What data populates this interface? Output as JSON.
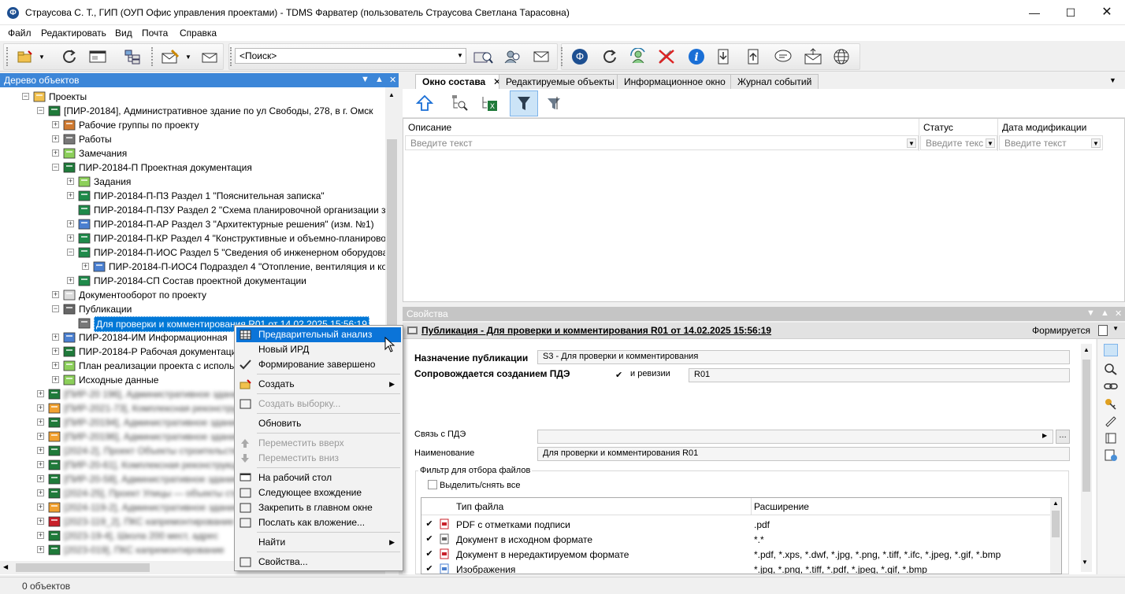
{
  "window": {
    "title": "Страусова С. Т., ГИП (ОУП Офис управления проектами) - TDMS Фарватер (пользователь Страусова Светлана Тарасовна)",
    "app_icon": "Ф"
  },
  "menu": [
    "Файл",
    "Редактировать",
    "Вид",
    "Почта",
    "Справка"
  ],
  "toolbar": {
    "search_placeholder": "<Поиск>"
  },
  "left_pane": {
    "title": "Дерево объектов",
    "tree": [
      {
        "label": "Проекты",
        "icon": "projects-icon",
        "level": 0
      },
      {
        "label": "[ПИР-20184], Административное здание по ул Свободы, 278, в г. Омск",
        "icon": "project-icon",
        "level": 1
      },
      {
        "label": "Рабочие группы по проекту",
        "icon": "group-icon",
        "level": 2
      },
      {
        "label": "Работы",
        "icon": "works-icon",
        "level": 2
      },
      {
        "label": "Замечания",
        "icon": "folder-green-icon",
        "level": 2
      },
      {
        "label": "ПИР-20184-П Проектная документация",
        "icon": "docs-icon",
        "level": 2
      },
      {
        "label": "Задания",
        "icon": "folder-green-icon",
        "level": 3
      },
      {
        "label": "ПИР-20184-П-ПЗ Раздел 1 \"Пояснительная записка\"",
        "icon": "section-icon",
        "level": 3
      },
      {
        "label": "ПИР-20184-П-ПЗУ Раздел 2 \"Схема планировочной организации з",
        "icon": "section-icon",
        "level": 3
      },
      {
        "label": "ПИР-20184-П-АР Раздел 3 \"Архитектурные решения\" (изм. №1)",
        "icon": "section-blue-icon",
        "level": 3
      },
      {
        "label": "ПИР-20184-П-КР Раздел 4 \"Конструктивные и объемно-планирово",
        "icon": "section-icon",
        "level": 3
      },
      {
        "label": "ПИР-20184-П-ИОС Раздел 5 \"Сведения об инженерном оборудова",
        "icon": "section-icon",
        "level": 3
      },
      {
        "label": "ПИР-20184-П-ИОС4 Подраздел 4 \"Отопление, вентиляция и ко",
        "icon": "section-blue-icon",
        "level": 4
      },
      {
        "label": "ПИР-20184-СП Состав проектной документации",
        "icon": "section-icon",
        "level": 3
      },
      {
        "label": "Документооборот по проекту",
        "icon": "folder-icon",
        "level": 2
      },
      {
        "label": "Публикации",
        "icon": "publications-icon",
        "level": 2
      },
      {
        "label": "Для проверки и комментирования R01 от 14.02.2025 15:56:19",
        "icon": "publication-icon",
        "level": 3,
        "selected": true
      },
      {
        "label": "ПИР-20184-ИМ Информационная",
        "icon": "section-blue-icon",
        "level": 2
      },
      {
        "label": "ПИР-20184-Р Рабочая документация",
        "icon": "docs-icon",
        "level": 2
      },
      {
        "label": "План реализации проекта с исполь",
        "icon": "folder-green-icon",
        "level": 2
      },
      {
        "label": "Исходные данные",
        "icon": "folder-green-icon",
        "level": 2
      },
      {
        "label": "[ПИР-20 196], Административное здание",
        "icon": "project-icon",
        "level": 1,
        "blurred": true
      },
      {
        "label": "[ПИР-2021-73], Комплексная реконструкция",
        "icon": "project-orange-icon",
        "level": 1,
        "blurred": true
      },
      {
        "label": "[ПИР-20194], Административное здание",
        "icon": "project-icon",
        "level": 1,
        "blurred": true
      },
      {
        "label": "[ПИР-20196], Административное здание",
        "icon": "project-orange-icon",
        "level": 1,
        "blurred": true
      },
      {
        "label": "[2024-2], Проект Объекты строительства",
        "icon": "project-icon",
        "level": 1,
        "blurred": true
      },
      {
        "label": "[ПИР-20-61], Комплексная реконструкция",
        "icon": "project-icon",
        "level": 1,
        "blurred": true
      },
      {
        "label": "[ПИР-20-58], Административное здание",
        "icon": "project-icon",
        "level": 1,
        "blurred": true
      },
      {
        "label": "[2024-25], Проект Улицы — объекты строй",
        "icon": "project-icon",
        "level": 1,
        "blurred": true
      },
      {
        "label": "[2024-119-2], Административное здание",
        "icon": "project-orange-icon",
        "level": 1,
        "blurred": true
      },
      {
        "label": "[2023-119_2], ПКС капремонтирование",
        "icon": "project-red-icon",
        "level": 1,
        "blurred": true
      },
      {
        "label": "[2023-19-4], Школа 200 мест, адрес",
        "icon": "project-icon",
        "level": 1,
        "blurred": true
      },
      {
        "label": "[2023-019], ПКС капремонтирование",
        "icon": "project-icon",
        "level": 1,
        "blurred": true
      }
    ]
  },
  "status": "0 объектов",
  "tabs": [
    {
      "label": "Окно состава",
      "active": true,
      "closable": true
    },
    {
      "label": "Редактируемые объекты",
      "active": false
    },
    {
      "label": "Информационное окно",
      "active": false
    },
    {
      "label": "Журнал событий",
      "active": false
    }
  ],
  "composition": {
    "columns": [
      {
        "header": "Описание",
        "filter": "Введите текст"
      },
      {
        "header": "Статус",
        "filter": "Введите текс"
      },
      {
        "header": "Дата модификации",
        "filter": "Введите текст"
      }
    ]
  },
  "properties": {
    "pane_title": "Свойства",
    "object_title": "Публикация - Для проверки и комментирования R01 от 14.02.2025 15:56:19",
    "state": "Формируется",
    "purpose_label": "Назначение публикации",
    "purpose_value": "S3 - Для проверки и комментирования",
    "pde_label": "Сопровождается созданием ПДЭ",
    "pde_checked": true,
    "revision_label": "и ревизии",
    "revision_value": "R01",
    "pde_link_label": "Связь с ПДЭ",
    "pde_link_value": "",
    "name_label": "Наименование",
    "name_value": "Для проверки и комментирования R01",
    "filter_group_label": "Фильтр для отбора файлов",
    "select_all_label": "Выделить/снять все",
    "file_table": {
      "headers": [
        "Тип файла",
        "Расширение"
      ],
      "rows": [
        {
          "type": "PDF с отметками подписи",
          "ext": ".pdf",
          "checked": true,
          "icon": "pdf-signed-icon"
        },
        {
          "type": "Документ в исходном формате",
          "ext": "*.*",
          "checked": true,
          "icon": "doc-edit-icon"
        },
        {
          "type": "Документ в нередактируемом формате",
          "ext": "*.pdf, *.xps, *.dwf, *.jpg, *.png, *.tiff, *.ifc,  *.jpeg, *.gif, *.bmp",
          "checked": true,
          "icon": "pdf-icon"
        },
        {
          "type": "Изображения",
          "ext": "*.jpg, *.png, *.tiff, *.pdf, *.jpeg, *.gif, *.bmp",
          "checked": true,
          "icon": "image-icon"
        }
      ]
    }
  },
  "context_menu": {
    "items": [
      {
        "label": "Предварительный анализ",
        "icon": "grid-icon",
        "highlighted": true
      },
      {
        "label": "Новый ИРД",
        "icon": "",
        "highlighted": false
      },
      {
        "label": "Формирование завершено",
        "icon": "check-icon"
      },
      {
        "separator": true
      },
      {
        "label": "Создать",
        "icon": "create-icon",
        "submenu": true
      },
      {
        "separator": true
      },
      {
        "label": "Создать выборку...",
        "icon": "selection-icon",
        "disabled": true
      },
      {
        "separator": true
      },
      {
        "label": "Обновить",
        "icon": ""
      },
      {
        "separator": true
      },
      {
        "label": "Переместить вверх",
        "icon": "arrow-up-icon",
        "disabled": true
      },
      {
        "label": "Переместить вниз",
        "icon": "arrow-down-icon",
        "disabled": true
      },
      {
        "separator": true
      },
      {
        "label": "На рабочий стол",
        "icon": "desktop-icon"
      },
      {
        "label": "Следующее вхождение",
        "icon": "next-occurrence-icon"
      },
      {
        "label": "Закрепить в главном окне",
        "icon": "pin-icon"
      },
      {
        "label": "Послать как вложение...",
        "icon": "attach-icon"
      },
      {
        "separator": true
      },
      {
        "label": "Найти",
        "icon": "",
        "submenu": true
      },
      {
        "separator": true
      },
      {
        "label": "Свойства...",
        "icon": "properties-icon"
      }
    ]
  },
  "colors": {
    "accent": "#3c86d8",
    "highlight": "#0b74d8",
    "selection": "#0078d7"
  }
}
